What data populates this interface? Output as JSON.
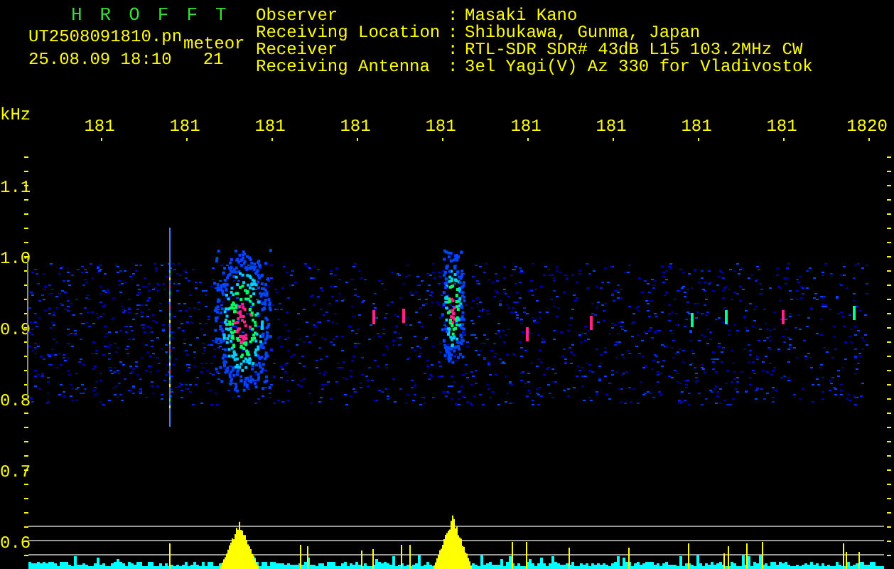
{
  "header": {
    "title": "HROFFT",
    "filename": "UT2508091810.pn",
    "tag": "meteor",
    "timestamp": "25.08.09 18:10",
    "count": "21"
  },
  "station": [
    {
      "label": "Observer",
      "separator": ":",
      "value": "Masaki Kano"
    },
    {
      "label": "Receiving Location",
      "separator": ":",
      "value": "Shibukawa, Gunma, Japan"
    },
    {
      "label": "Receiver",
      "separator": ":",
      "value": "RTL-SDR SDR# 43dB L15 103.2MHz CW"
    },
    {
      "label": "Receiving Antenna",
      "separator": ":",
      "value": "3el Yagi(V) Az 330 for Vladivostok"
    }
  ],
  "plot": {
    "y_unit": "kHz",
    "y_labels": [
      "1.1",
      "1.0",
      "0.9",
      "0.8",
      "0.7",
      "0.6"
    ],
    "x_labels": [
      "181",
      "181",
      "181",
      "181",
      "181",
      "181",
      "181",
      "181",
      "181",
      "1820"
    ]
  }
}
